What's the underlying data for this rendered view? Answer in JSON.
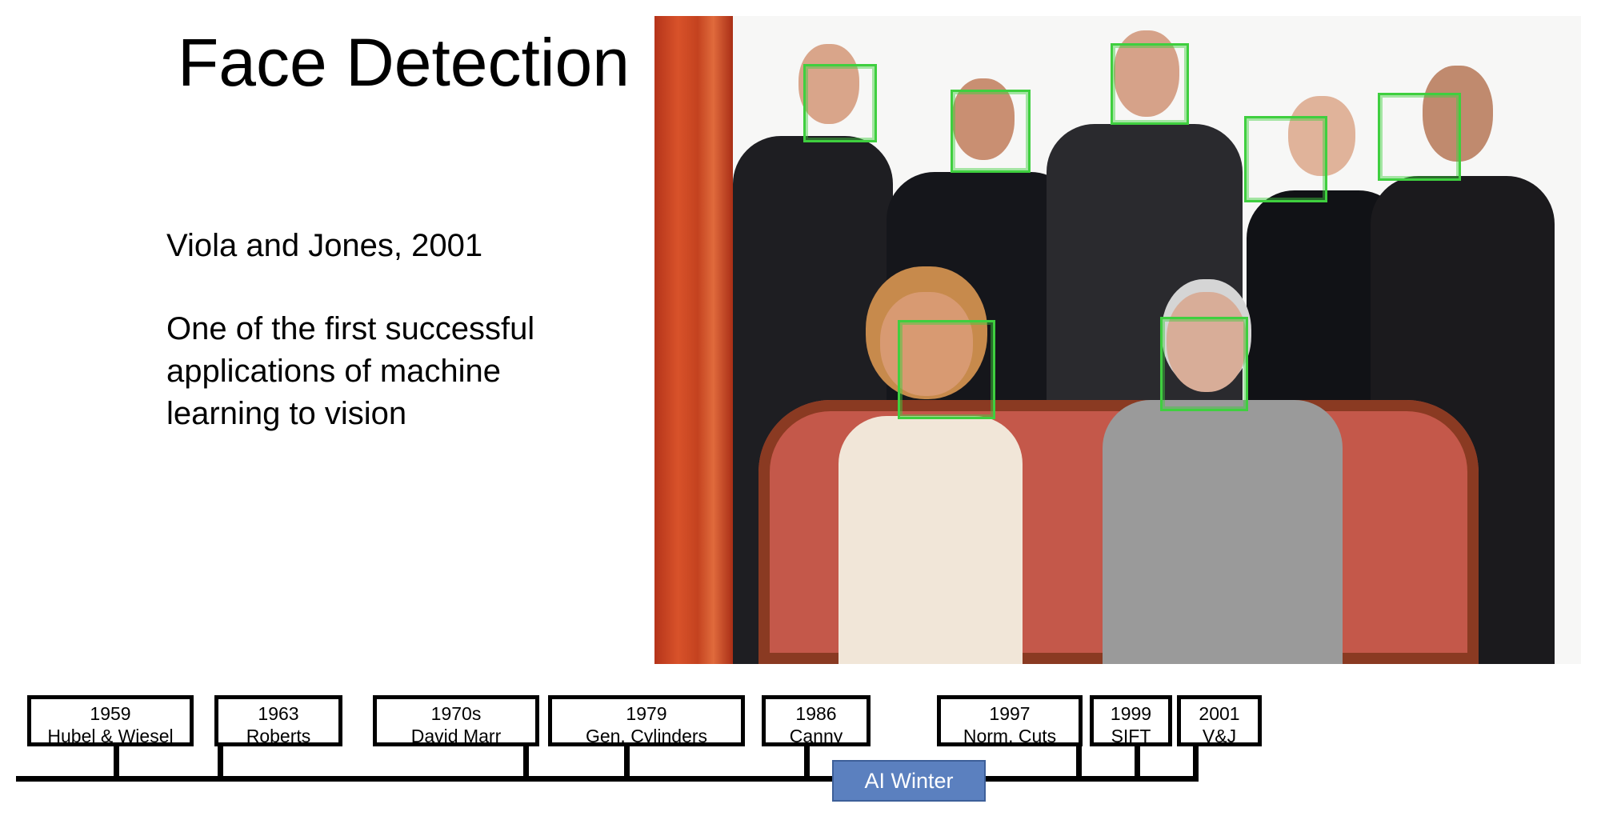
{
  "slide": {
    "title": "Face Detection",
    "subtitle": "Viola and Jones, 2001",
    "description_lines": [
      "One of the first successful",
      "applications of machine",
      "learning to vision"
    ]
  },
  "timeline": {
    "events": [
      {
        "year": "1959",
        "label": "Hubel & Wiesel"
      },
      {
        "year": "1963",
        "label": "Roberts"
      },
      {
        "year": "1970s",
        "label": "David Marr"
      },
      {
        "year": "1979",
        "label": "Gen. Cylinders"
      },
      {
        "year": "1986",
        "label": "Canny"
      },
      {
        "year": "1997",
        "label": "Norm. Cuts"
      },
      {
        "year": "1999",
        "label": "SIFT"
      },
      {
        "year": "2001",
        "label": "V&J"
      }
    ],
    "highlight": "AI Winter"
  },
  "colors": {
    "detection_box": "#3fcf3f",
    "highlight_fill": "#5b80bf",
    "curtain": "#c4421f",
    "sofa": "#c4584a"
  }
}
